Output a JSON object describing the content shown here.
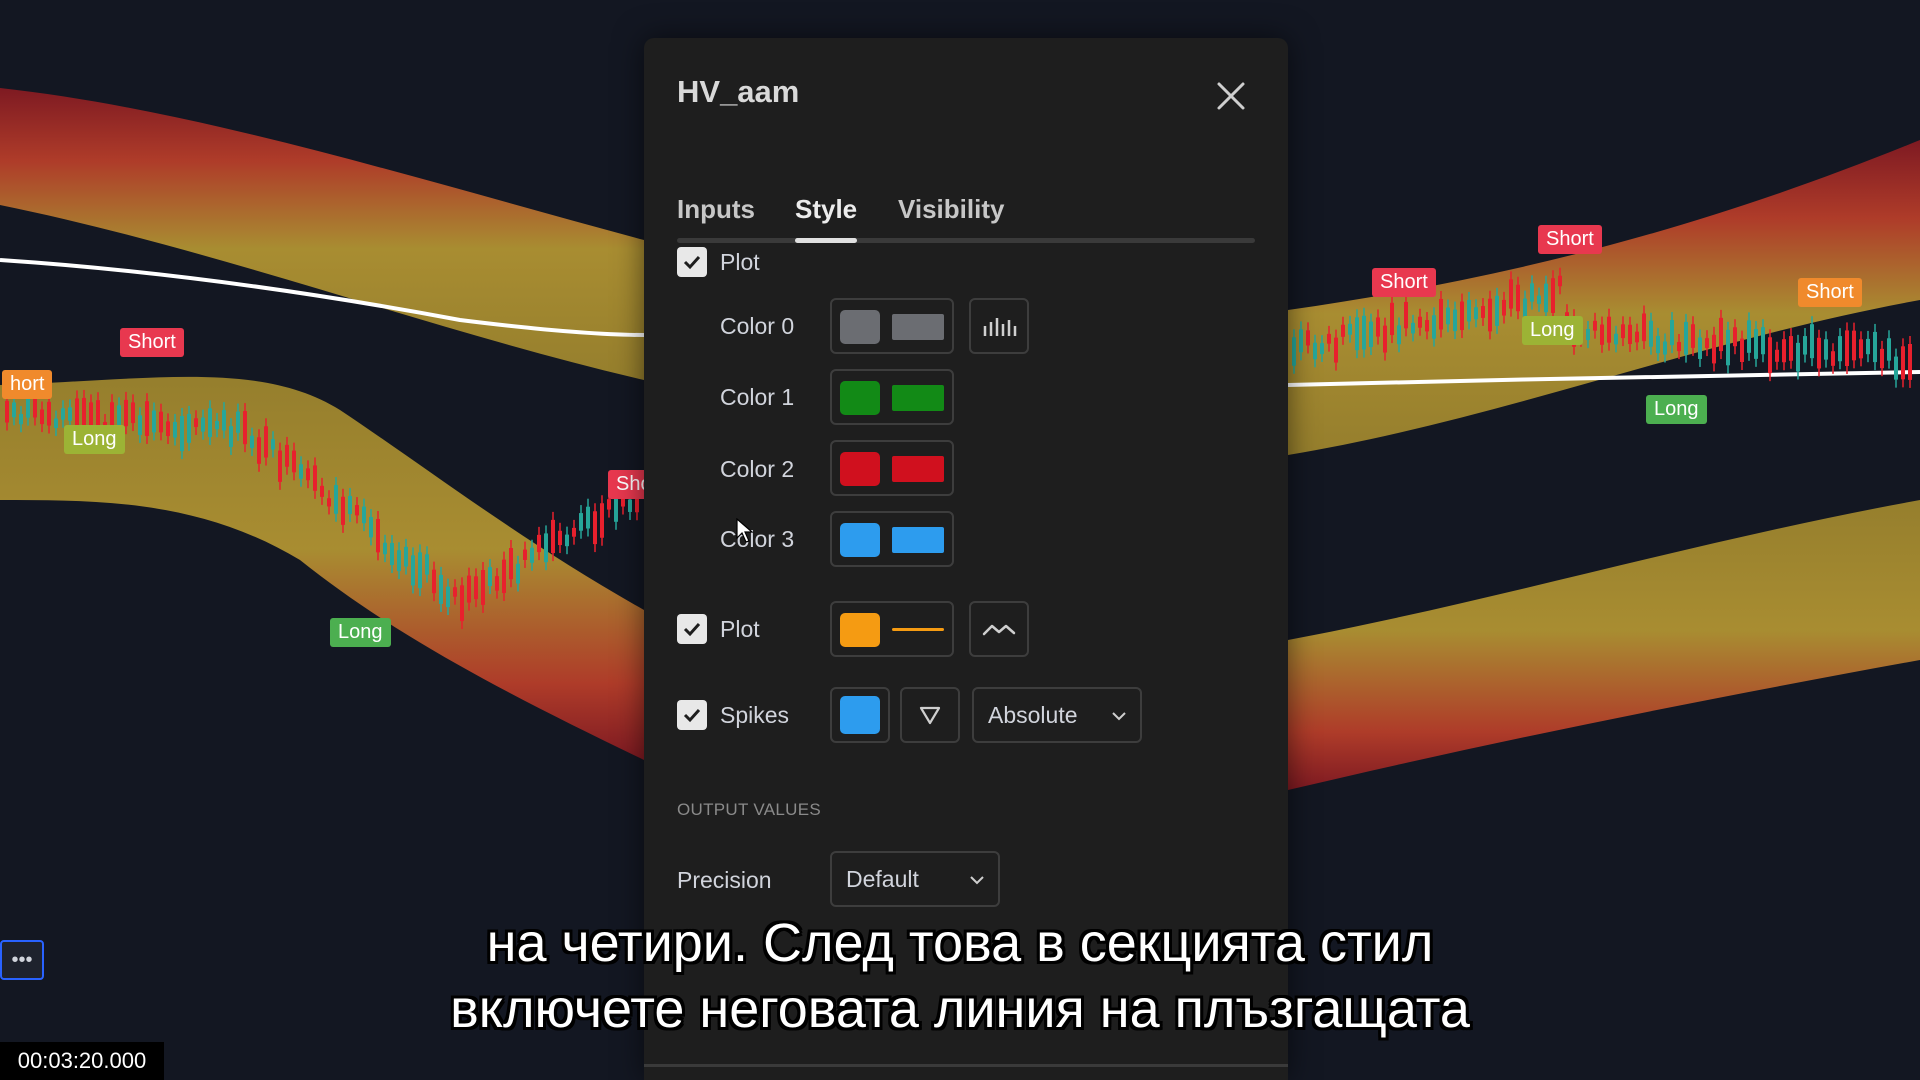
{
  "dialog": {
    "title": "HV_aam",
    "tabs": [
      "Inputs",
      "Style",
      "Visibility"
    ],
    "active_tab": "Style",
    "plot1": {
      "label": "Plot",
      "checked": true,
      "colors": [
        {
          "label": "Color 0",
          "color": "#6b6d72",
          "has_bars_button": true
        },
        {
          "label": "Color 1",
          "color": "#128a16"
        },
        {
          "label": "Color 2",
          "color": "#d0101e"
        },
        {
          "label": "Color 3",
          "color": "#2d9cee"
        }
      ],
      "bars_icon": "histogram-icon"
    },
    "plot2": {
      "label": "Plot",
      "checked": true,
      "color": "#f59b12",
      "style_icon": "line-style-icon"
    },
    "spikes": {
      "label": "Spikes",
      "checked": true,
      "color": "#2d9cee",
      "shape_icon": "triangle-down-icon",
      "mode": "Absolute"
    },
    "output_values": {
      "heading": "OUTPUT VALUES",
      "precision_label": "Precision",
      "precision_value": "Default"
    }
  },
  "chart": {
    "signals": [
      {
        "text": "Short",
        "kind": "short"
      },
      {
        "text": "hort",
        "kind": "short-orange"
      },
      {
        "text": "Long",
        "kind": "long-olive"
      },
      {
        "text": "Long",
        "kind": "long"
      },
      {
        "text": "Sho",
        "kind": "short"
      },
      {
        "text": "Short",
        "kind": "short"
      },
      {
        "text": "Short",
        "kind": "short"
      },
      {
        "text": "Short",
        "kind": "short-orange"
      },
      {
        "text": "Long",
        "kind": "long-olive"
      },
      {
        "text": "Long",
        "kind": "long"
      }
    ],
    "colors": {
      "up": "#26a69a",
      "down": "#e8202d",
      "band_inner": "#c9b13a",
      "band_outer": "#b3142a",
      "center_line": "#f3f0c8"
    }
  },
  "subtitle": {
    "line1": "на четири. След това в секцията стил",
    "line2": "включете неговата линия на плъзгащата"
  },
  "timestamp": "00:03:20.000",
  "more_button": "more-icon"
}
